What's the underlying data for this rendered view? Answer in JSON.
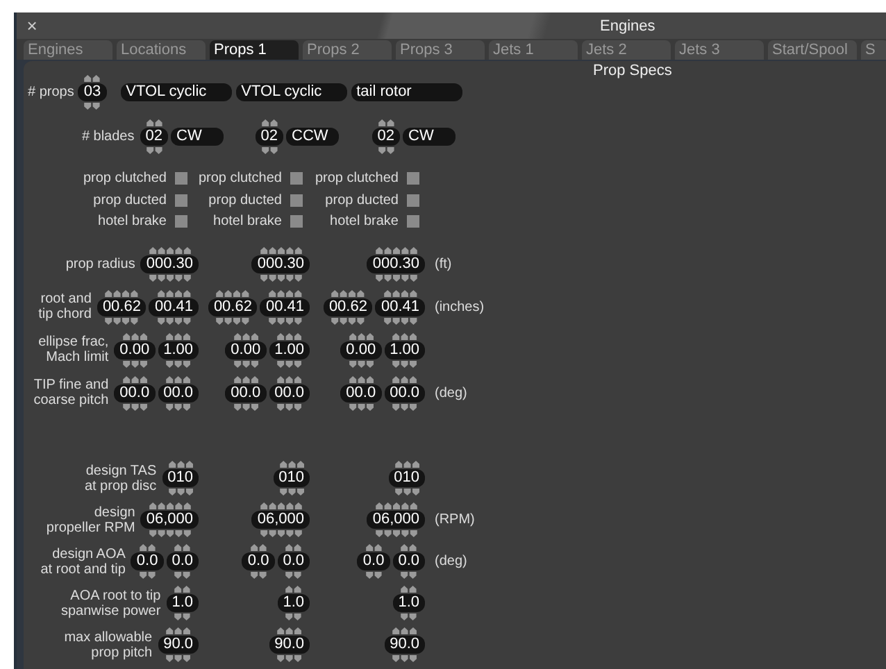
{
  "window": {
    "title": "Engines",
    "close": "×"
  },
  "tabs": [
    {
      "label": "Engines",
      "selected": false
    },
    {
      "label": "Locations",
      "selected": false
    },
    {
      "label": "Props 1",
      "selected": true
    },
    {
      "label": "Props 2",
      "selected": false
    },
    {
      "label": "Props 3",
      "selected": false
    },
    {
      "label": "Jets 1",
      "selected": false
    },
    {
      "label": "Jets 2",
      "selected": false
    },
    {
      "label": "Jets 3",
      "selected": false
    },
    {
      "label": "Start/Spool",
      "selected": false
    },
    {
      "label": "S",
      "selected": false
    }
  ],
  "section_title": "Prop Specs",
  "props_count": {
    "label": "# props",
    "value": "03"
  },
  "prop_names": [
    "VTOL cyclic",
    "VTOL cyclic",
    "tail rotor"
  ],
  "blades": {
    "label": "# blades",
    "props": [
      {
        "count": "02",
        "direction": "CW"
      },
      {
        "count": "02",
        "direction": "CCW"
      },
      {
        "count": "02",
        "direction": "CW"
      }
    ]
  },
  "checkbox_rows": [
    {
      "items": [
        {
          "label": "prop clutched",
          "checked": false
        },
        {
          "label": "prop clutched",
          "checked": false
        },
        {
          "label": "prop clutched",
          "checked": false
        }
      ]
    },
    {
      "items": [
        {
          "label": "prop ducted",
          "checked": false
        },
        {
          "label": "prop ducted",
          "checked": false
        },
        {
          "label": "prop ducted",
          "checked": false
        }
      ]
    },
    {
      "items": [
        {
          "label": "hotel brake",
          "checked": false
        },
        {
          "label": "hotel brake",
          "checked": false
        },
        {
          "label": "hotel brake",
          "checked": false
        }
      ]
    }
  ],
  "spec_groups": [
    [
      {
        "label": "prop radius",
        "values": [
          [
            "000.30"
          ],
          [
            "000.30"
          ],
          [
            "000.30"
          ]
        ],
        "unit": "(ft)"
      },
      {
        "label": "root and\ntip chord",
        "values": [
          [
            "00.62",
            "00.41"
          ],
          [
            "00.62",
            "00.41"
          ],
          [
            "00.62",
            "00.41"
          ]
        ],
        "unit": "(inches)"
      },
      {
        "label": "ellipse frac,\nMach limit",
        "values": [
          [
            "0.00",
            "1.00"
          ],
          [
            "0.00",
            "1.00"
          ],
          [
            "0.00",
            "1.00"
          ]
        ]
      },
      {
        "label": "TIP fine and\ncoarse pitch",
        "values": [
          [
            "00.0",
            "00.0"
          ],
          [
            "00.0",
            "00.0"
          ],
          [
            "00.0",
            "00.0"
          ]
        ],
        "unit": "(deg)"
      }
    ],
    [
      {
        "label": "design TAS\nat prop disc",
        "values": [
          [
            "010"
          ],
          [
            "010"
          ],
          [
            "010"
          ]
        ]
      },
      {
        "label": "design\npropeller RPM",
        "values": [
          [
            "06,000"
          ],
          [
            "06,000"
          ],
          [
            "06,000"
          ]
        ],
        "unit": "(RPM)"
      },
      {
        "label": "design AOA\nat root and tip",
        "values": [
          [
            "0.0",
            "0.0"
          ],
          [
            "0.0",
            "0.0"
          ],
          [
            "0.0",
            "0.0"
          ]
        ],
        "unit": "(deg)"
      },
      {
        "label": "AOA root to tip\nspanwise power",
        "values": [
          [
            "1.0"
          ],
          [
            "1.0"
          ],
          [
            "1.0"
          ]
        ]
      },
      {
        "label": "max allowable\nprop pitch",
        "values": [
          [
            "90.0"
          ],
          [
            "90.0"
          ],
          [
            "90.0"
          ]
        ]
      }
    ]
  ]
}
